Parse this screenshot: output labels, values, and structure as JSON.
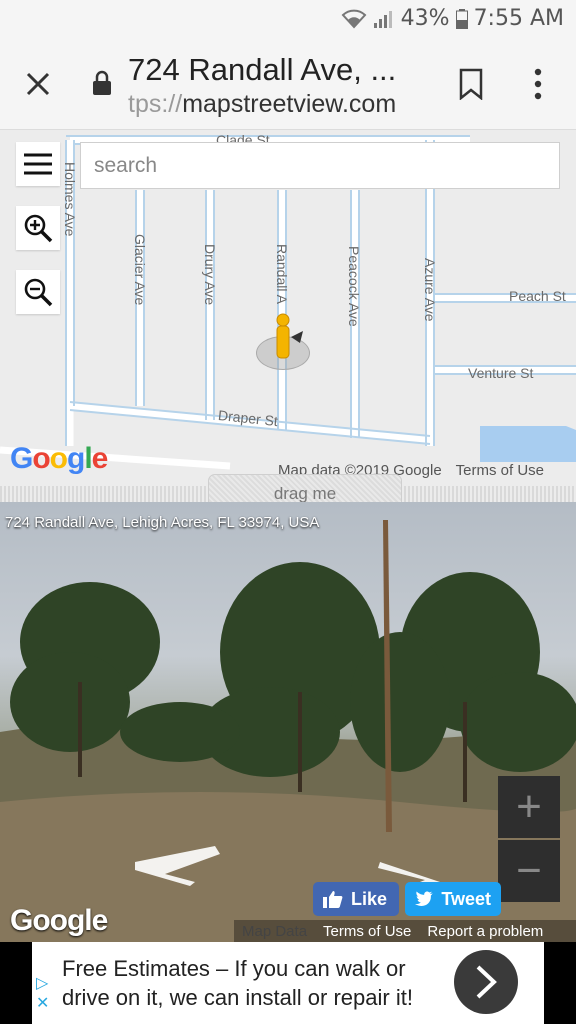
{
  "status_bar": {
    "battery": "43%",
    "time": "7:55 AM"
  },
  "browser": {
    "title": "724 Randall Ave, ...",
    "url_prefix": "tps://",
    "url_domain": "mapstreetview.com"
  },
  "map": {
    "search_placeholder": "search",
    "streets": {
      "holmes": "Holmes Ave",
      "glacier": "Glacier Ave",
      "drury": "Drury Ave",
      "randall": "Randall A",
      "peacock": "Peacock Ave",
      "azure": "Azure Ave",
      "peach": "Peach St",
      "venture": "Venture St",
      "draper": "Draper St",
      "top_cut": "Clade St"
    },
    "attribution": "Map data ©2019 Google",
    "terms": "Terms of Use",
    "google": "Google"
  },
  "drag_label": "drag me",
  "streetview": {
    "address": "724 Randall Ave, Lehigh Acres, FL 33974, USA",
    "zoom_in": "+",
    "zoom_out": "−",
    "like_label": "Like",
    "tweet_label": "Tweet",
    "google": "Google",
    "footer": {
      "map_data": "Map Data",
      "terms": "Terms of Use",
      "report": "Report a problem"
    }
  },
  "ad": {
    "line1": "Free Estimates – If you can walk or",
    "line2": "drive on it, we can install or repair it!"
  }
}
